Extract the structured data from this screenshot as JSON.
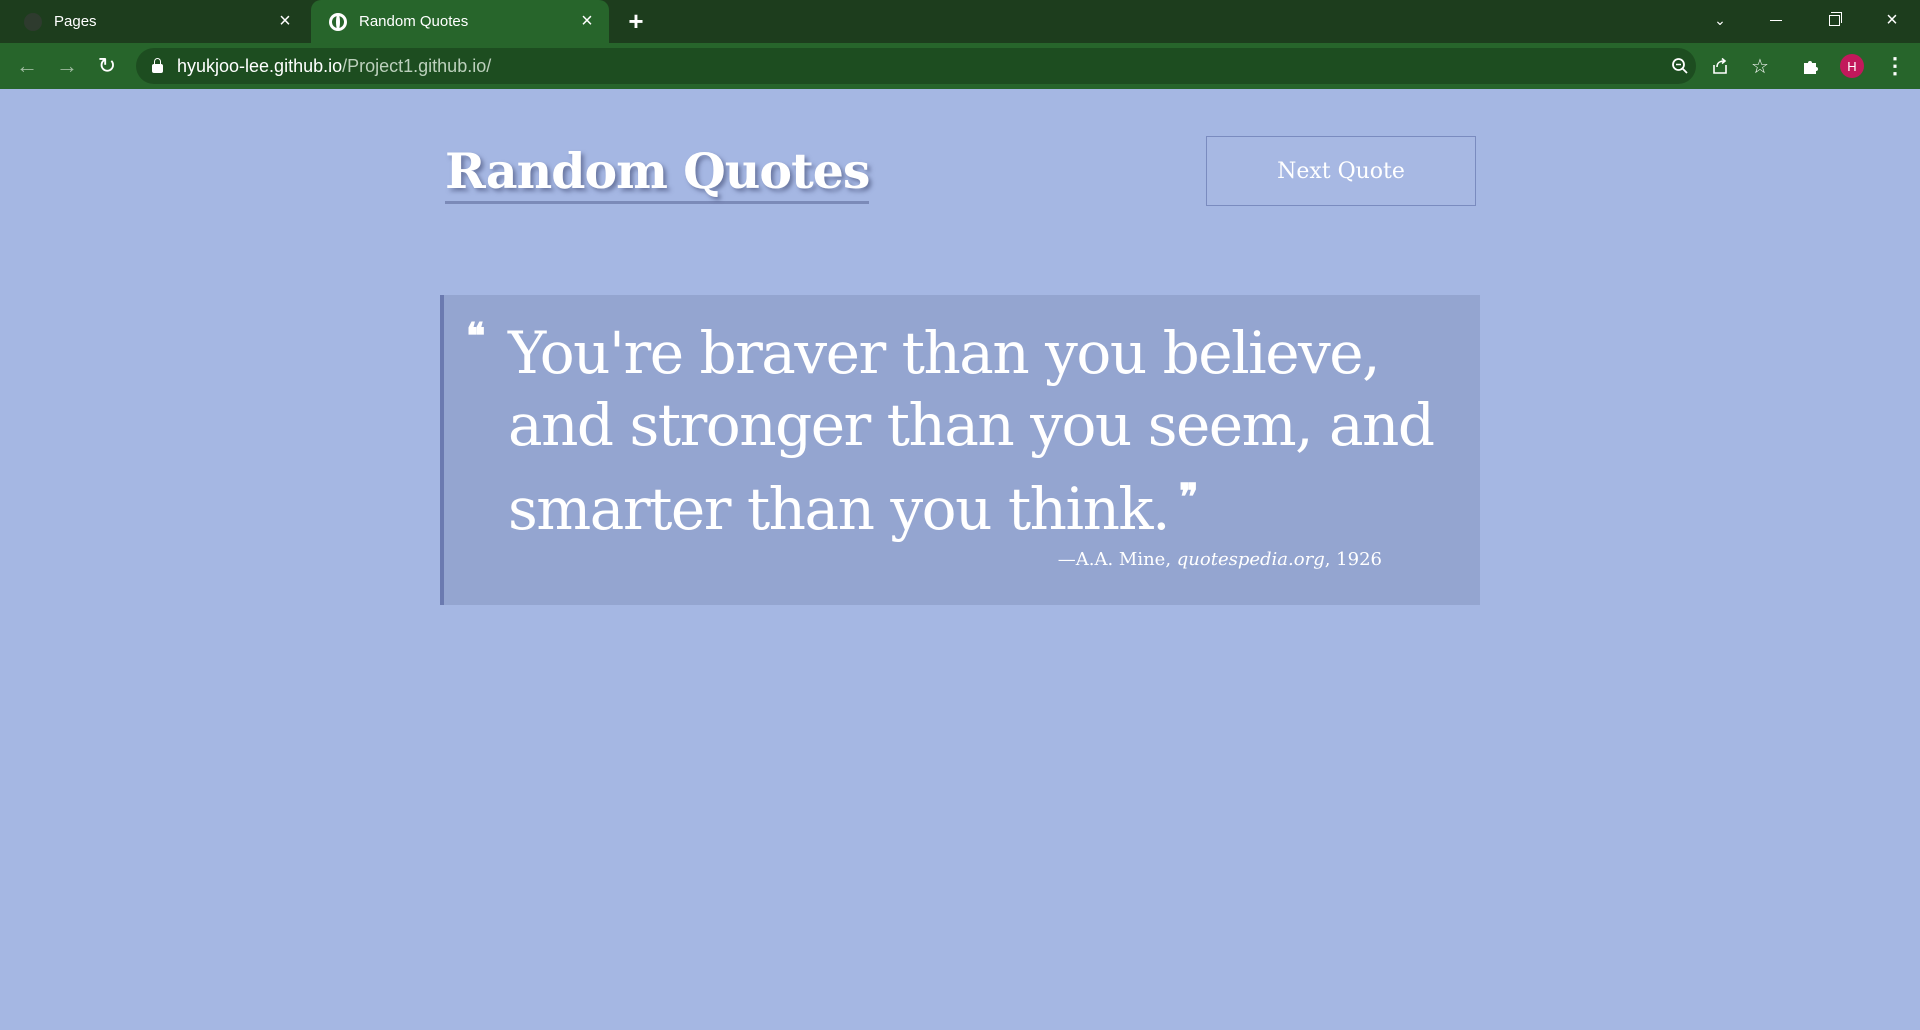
{
  "browser": {
    "tabs": [
      {
        "title": "Pages",
        "active": false
      },
      {
        "title": "Random Quotes",
        "active": true
      }
    ],
    "new_tab_symbol": "+",
    "close_symbol": "×",
    "url_host": "hyukjoo-lee.github.io",
    "url_path": "/Project1.github.io/",
    "profile_initial": "H",
    "icons": {
      "back": "←",
      "forward": "→",
      "reload": "↻",
      "zoom": "🔍",
      "share": "⇪",
      "star": "☆",
      "extensions": "✲",
      "menu": "⋮",
      "dropdown": "⌄"
    },
    "accent_color": "#27652b",
    "tabbar_color": "#1d3d1d"
  },
  "page": {
    "title": "Random Quotes",
    "next_button_label": "Next Quote",
    "background_color": "#a5b7e3",
    "quote": {
      "open_mark": "❝",
      "text": "You're braver than you believe, and stronger than you seem, and smarter than you think.",
      "close_mark": "❞",
      "author_prefix": "—A.A. Mine, ",
      "citation": "quotespedia.org",
      "year_suffix": ", 1926"
    }
  }
}
